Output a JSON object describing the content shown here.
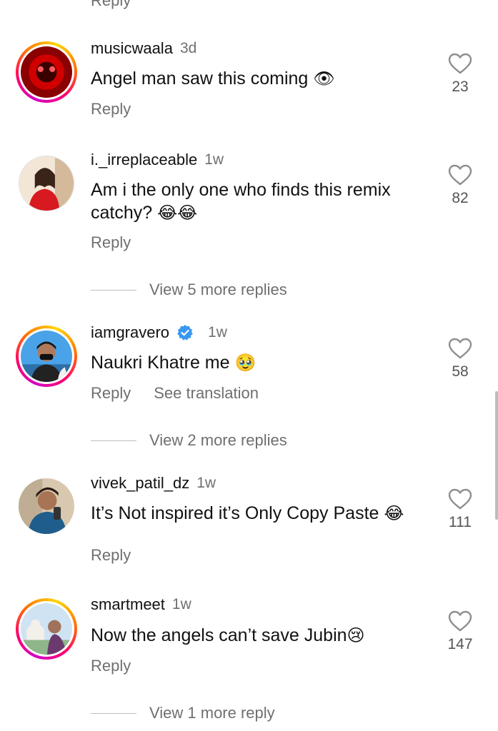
{
  "top_partial": {
    "reply_label": "Reply"
  },
  "comments": [
    {
      "username": "musicwaala",
      "time": "3d",
      "text": "Angel man saw this coming",
      "emoji": "👁",
      "likes": "23",
      "reply_label": "Reply",
      "verified": false,
      "story_ring": true
    },
    {
      "username": "i._irreplaceable",
      "time": "1w",
      "text_line1": "Am i the only one who finds this remix",
      "text_line2": "catchy?",
      "emoji": "😂😂",
      "likes": "82",
      "reply_label": "Reply",
      "verified": false,
      "story_ring": false,
      "view_replies": "View 5 more replies"
    },
    {
      "username": "iamgravero",
      "time": "1w",
      "text": "Naukri Khatre me",
      "emoji": "🥹",
      "likes": "58",
      "reply_label": "Reply",
      "translation_label": "See translation",
      "verified": true,
      "story_ring": true,
      "view_replies": "View 2 more replies"
    },
    {
      "username": "vivek_patil_dz",
      "time": "1w",
      "text": "It’s Not inspired it’s Only Copy Paste",
      "emoji": "😂",
      "likes": "111",
      "reply_label": "Reply",
      "verified": false,
      "story_ring": false
    },
    {
      "username": "smartmeet",
      "time": "1w",
      "text": "Now the angels can’t save Jubin",
      "emoji": "😢",
      "likes": "147",
      "reply_label": "Reply",
      "verified": false,
      "story_ring": true,
      "view_replies": "View 1 more reply"
    }
  ],
  "colors": {
    "secondary_text": "#6f6f6f",
    "verified_blue": "#3897f0",
    "like_outline": "#8e8e8e"
  }
}
